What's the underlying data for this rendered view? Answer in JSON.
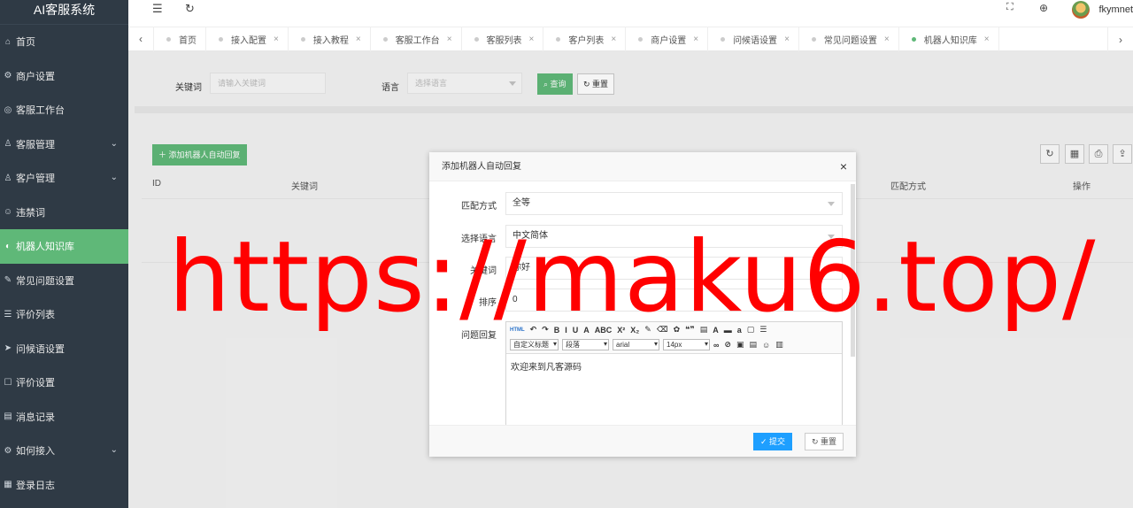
{
  "app": {
    "title": "AI客服系统"
  },
  "sidebar": {
    "items": [
      {
        "label": "首页",
        "icon": "home-icon",
        "glyph": "⌂"
      },
      {
        "label": "商户设置",
        "icon": "gear-icon",
        "glyph": "⚙"
      },
      {
        "label": "客服工作台",
        "icon": "headset-icon",
        "glyph": "◎"
      },
      {
        "label": "客服管理",
        "icon": "user-icon",
        "glyph": "♙",
        "chevron": "⌄"
      },
      {
        "label": "客户管理",
        "icon": "customer-icon",
        "glyph": "♙",
        "chevron": "⌄"
      },
      {
        "label": "违禁词",
        "icon": "smile-icon",
        "glyph": "☺"
      },
      {
        "label": "机器人知识库",
        "icon": "robot-icon",
        "glyph": "◐",
        "active": true
      },
      {
        "label": "常见问题设置",
        "icon": "edit-icon",
        "glyph": "✎"
      },
      {
        "label": "评价列表",
        "icon": "list-icon",
        "glyph": "☰"
      },
      {
        "label": "问候语设置",
        "icon": "send-icon",
        "glyph": "➤"
      },
      {
        "label": "评价设置",
        "icon": "rate-icon",
        "glyph": "☐"
      },
      {
        "label": "消息记录",
        "icon": "message-icon",
        "glyph": "▤"
      },
      {
        "label": "如何接入",
        "icon": "link-icon",
        "glyph": "⚙",
        "chevron": "⌄"
      },
      {
        "label": "登录日志",
        "icon": "log-icon",
        "glyph": "▦"
      }
    ]
  },
  "header": {
    "menu_icon": "☰",
    "refresh_icon": "↻",
    "fullscreen_icon": "⛶",
    "globe_icon": "⊕",
    "username": "fkymnet"
  },
  "tabs": {
    "prev": "‹",
    "next": "›",
    "close": "×",
    "items": [
      {
        "label": "首页",
        "closable": false
      },
      {
        "label": "接入配置",
        "closable": true
      },
      {
        "label": "接入教程",
        "closable": true
      },
      {
        "label": "客服工作台",
        "closable": true
      },
      {
        "label": "客服列表",
        "closable": true
      },
      {
        "label": "客户列表",
        "closable": true
      },
      {
        "label": "商户设置",
        "closable": true
      },
      {
        "label": "问候语设置",
        "closable": true
      },
      {
        "label": "常见问题设置",
        "closable": true
      },
      {
        "label": "机器人知识库",
        "closable": true,
        "active": true
      }
    ]
  },
  "search": {
    "keyword_label": "关键词",
    "keyword_placeholder": "请输入关键词",
    "language_label": "语言",
    "language_placeholder": "选择语言",
    "query_button": "查询",
    "reset_button": "重置"
  },
  "table": {
    "add_button": "＋ 添加机器人自动回复",
    "columns": [
      "ID",
      "关键词",
      "匹配方式",
      "操作"
    ],
    "tools": [
      "↻",
      "▦",
      "⎙",
      "⇪"
    ]
  },
  "modal": {
    "title": "添加机器人自动回复",
    "close": "×",
    "match_label": "匹配方式",
    "match_value": "全等",
    "language_label": "选择语言",
    "language_value": "中文简体",
    "keyword_label": "关键词",
    "keyword_value": "你好",
    "sort_label": "排序",
    "sort_value": "0",
    "answer_label": "问题回复",
    "editor": {
      "row1": [
        "HTML",
        "↶",
        "↷",
        "B",
        "I",
        "U",
        "A",
        "ABC",
        "X²",
        "X₂",
        "✎",
        "⌫",
        "✿",
        "❝❞",
        "▤",
        "A",
        "▬",
        "a",
        "▢",
        "☰"
      ],
      "combos": [
        "自定义标题",
        "段落",
        "arial",
        "14px"
      ],
      "row2_extra": [
        "∞",
        "⊘",
        "▣",
        "▤",
        "☺",
        "▥"
      ],
      "content": "欢迎来到凡客源码"
    },
    "submit_button": "提交",
    "reset_button": "重置"
  },
  "watermark": "https://maku6.top/",
  "colors": {
    "sidebar": "#2f3a45",
    "accent_green": "#5fb878",
    "primary_blue": "#1e9fff",
    "watermark": "#ff0000"
  }
}
